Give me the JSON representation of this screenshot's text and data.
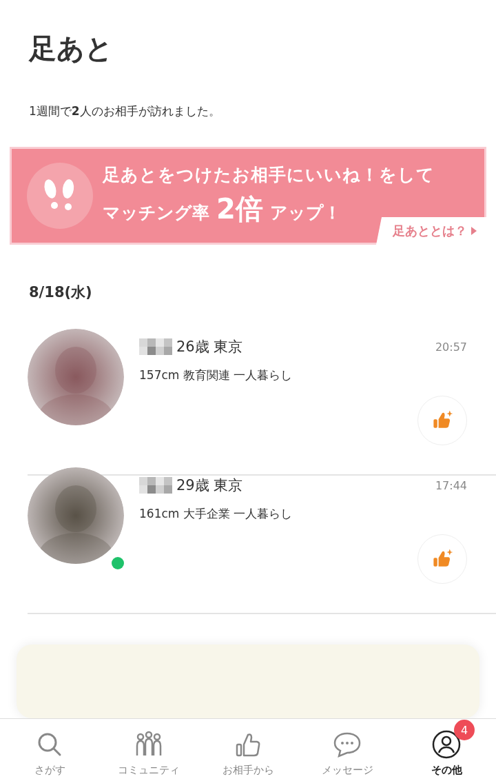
{
  "title": "足あと",
  "summary": "1週間で**2**人のお相手が訪れました。",
  "banner": {
    "line1": "足あとをつけたお相手にいいね！をして",
    "line2_before": "マッチング率",
    "line2_big": "2倍",
    "line2_after": "アップ！",
    "link": "足あととは？"
  },
  "date": "8/18(水)",
  "visitors": [
    {
      "age_area": "26歳 東京",
      "time": "20:57",
      "profile": "157cm 教育関連 一人暮らし",
      "online": false
    },
    {
      "age_area": "29歳 東京",
      "time": "17:44",
      "profile": "161cm 大手企業 一人暮らし",
      "online": true
    }
  ],
  "promo": {
    "kind": "card"
  },
  "tabs": [
    {
      "label": "さがす",
      "selected": false
    },
    {
      "label": "コミュニティ",
      "selected": false
    },
    {
      "label": "お相手から",
      "selected": false
    },
    {
      "label": "メッセージ",
      "selected": false
    },
    {
      "label": "その他",
      "selected": true,
      "badge": "4"
    }
  ]
}
